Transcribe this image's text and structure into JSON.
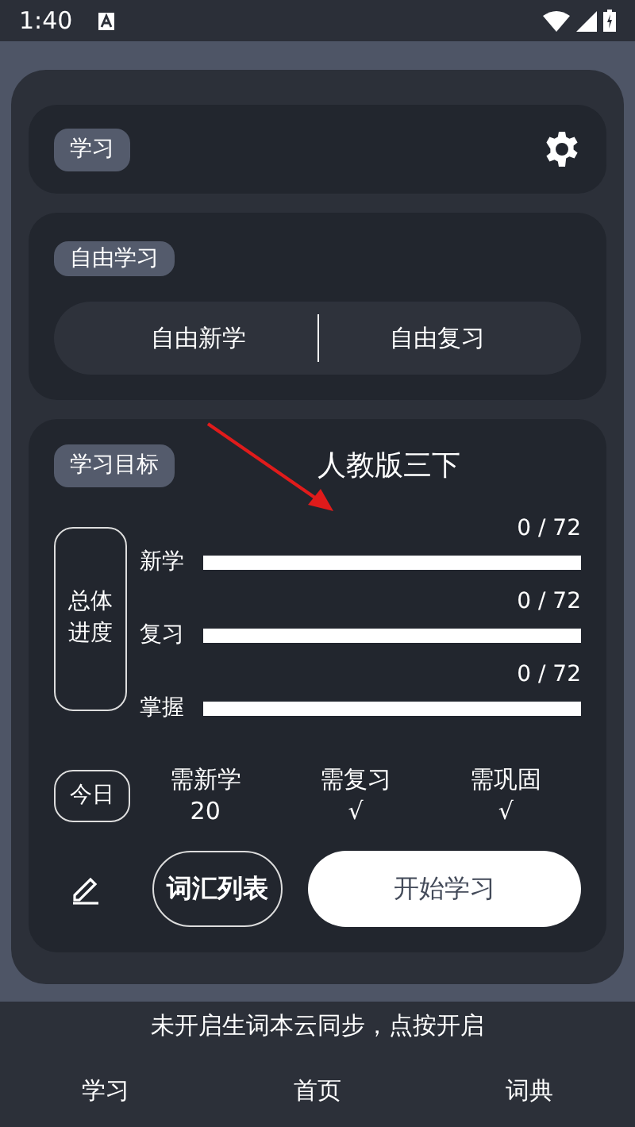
{
  "status_bar": {
    "time": "1:40"
  },
  "header": {
    "tag": "学习"
  },
  "free_study": {
    "tag": "自由学习",
    "options": [
      "自由新学",
      "自由复习"
    ]
  },
  "goal": {
    "tag": "学习目标",
    "book": "人教版三下",
    "overall_label": "总体进度",
    "progress": [
      {
        "label": "新学",
        "reading": "0 / 72",
        "level": 0
      },
      {
        "label": "复习",
        "reading": "0 / 72",
        "level": 0
      },
      {
        "label": "掌握",
        "reading": "0 / 72",
        "level": 0
      }
    ],
    "today_label": "今日",
    "today": [
      {
        "label": "需新学",
        "value": "20"
      },
      {
        "label": "需复习",
        "value": "√"
      },
      {
        "label": "需巩固",
        "value": "√"
      }
    ],
    "word_list_button": "词汇列表",
    "start_button": "开始学习"
  },
  "sync_notice": "未开启生词本云同步，点按开启",
  "bottom_nav": [
    "学习",
    "首页",
    "词典"
  ]
}
